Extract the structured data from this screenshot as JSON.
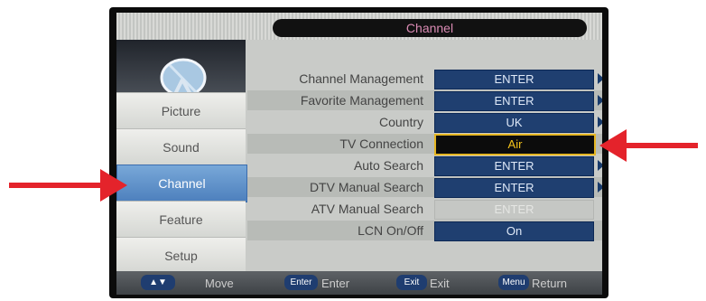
{
  "title": "Channel",
  "sidebar": {
    "items": [
      "Picture",
      "Sound",
      "Channel",
      "Feature",
      "Setup"
    ],
    "active": "Channel"
  },
  "settings": [
    {
      "label": "Channel Management",
      "value": "ENTER"
    },
    {
      "label": "Favorite Management",
      "value": "ENTER"
    },
    {
      "label": "Country",
      "value": "UK"
    },
    {
      "label": "TV Connection",
      "value": "Air"
    },
    {
      "label": "Auto Search",
      "value": "ENTER"
    },
    {
      "label": "DTV Manual Search",
      "value": "ENTER"
    },
    {
      "label": "ATV Manual Search",
      "value": "ENTER"
    },
    {
      "label": "LCN On/Off",
      "value": "On"
    }
  ],
  "help": {
    "move_key": "▲▼",
    "move": "Move",
    "enter_key": "Enter",
    "enter": "Enter",
    "exit_key": "Exit",
    "exit": "Exit",
    "menu_key": "Menu",
    "return": "Return"
  },
  "colors": {
    "highlight": "#4d80bd",
    "selected_border": "#e5b623",
    "annotation_arrow": "#e4232b"
  }
}
